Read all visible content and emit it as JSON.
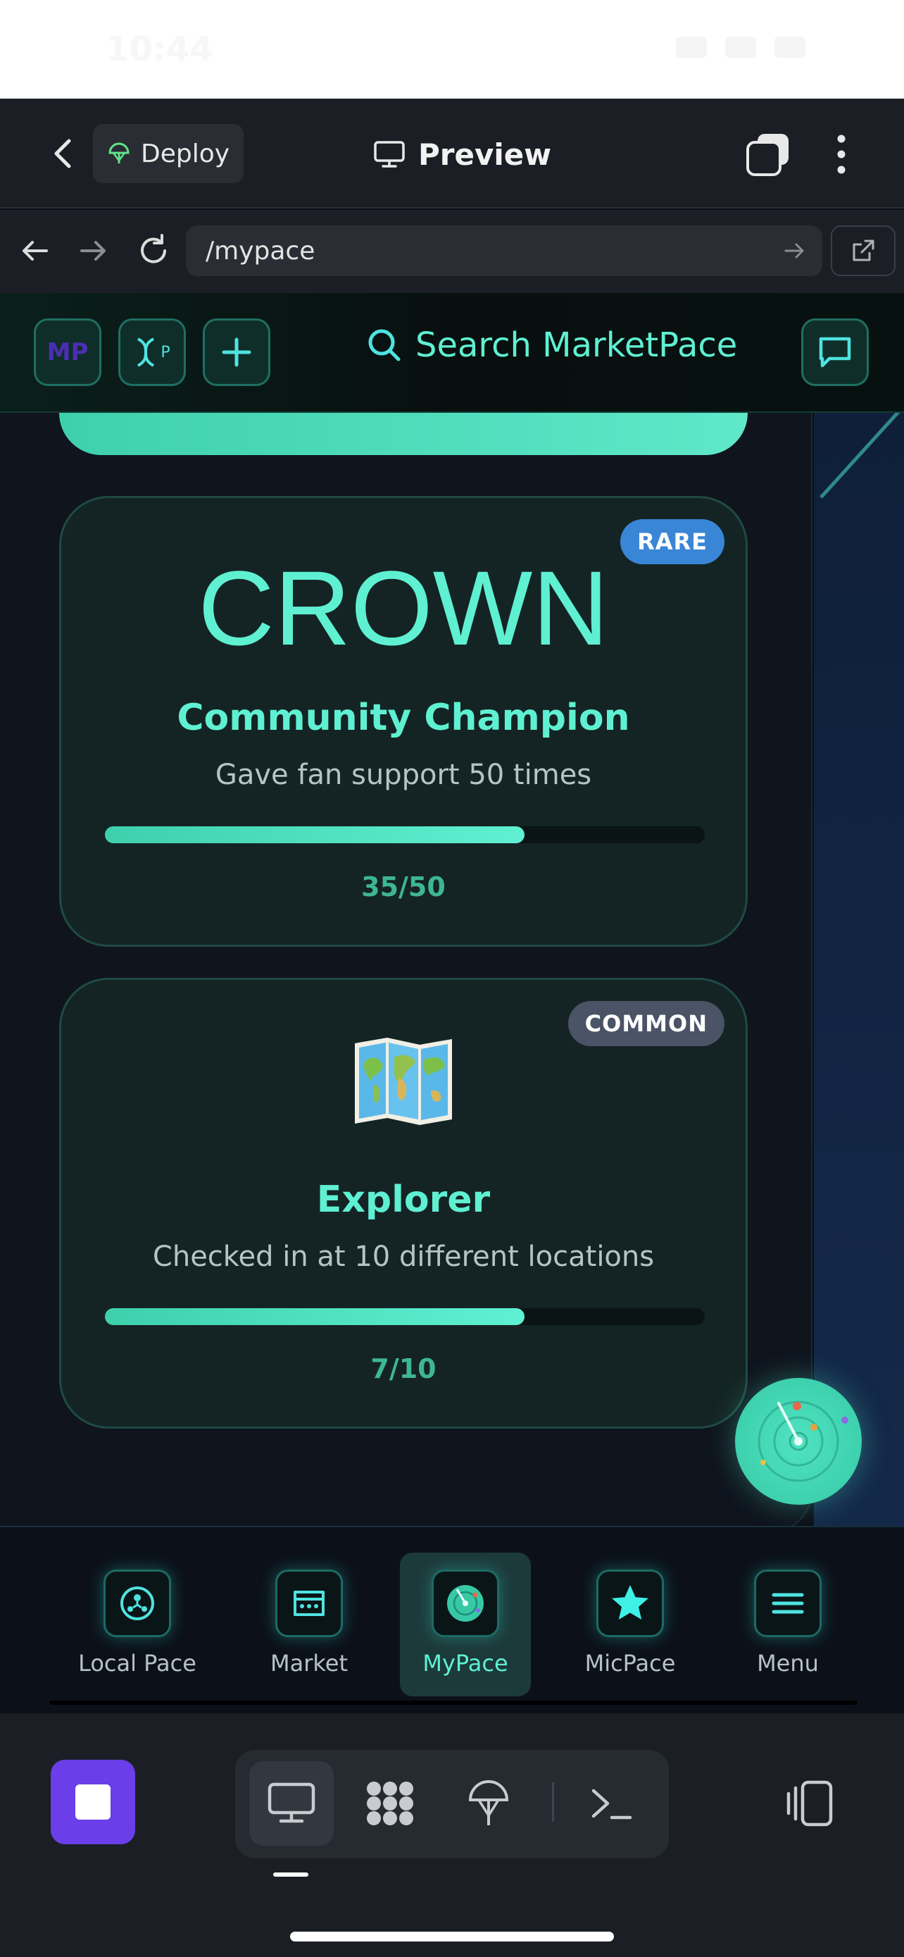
{
  "status_bar": {
    "time": "10:44"
  },
  "toolbar": {
    "deploy_label": "Deploy",
    "preview_label": "Preview"
  },
  "url_bar": {
    "url": "/mypace"
  },
  "app_header": {
    "logo_text": "MP",
    "second_btn_text": "P",
    "search_placeholder": "Search MarketPace"
  },
  "cards": [
    {
      "badge": "RARE",
      "icon_text": "CROWN",
      "title": "Community Champion",
      "description": "Gave fan support 50 times",
      "count": "35/50",
      "progress_fraction": 0.7
    },
    {
      "badge": "COMMON",
      "icon": "world-map-icon",
      "title": "Explorer",
      "description": "Checked in at 10 different locations",
      "count": "7/10",
      "progress_fraction": 0.7
    }
  ],
  "bottom_nav": {
    "items": [
      {
        "label": "Local Pace",
        "icon": "local-pace-icon"
      },
      {
        "label": "Market",
        "icon": "market-icon"
      },
      {
        "label": "MyPace",
        "icon": "mypace-radar-icon",
        "active": true
      },
      {
        "label": "MicPace",
        "icon": "star-icon"
      },
      {
        "label": "Menu",
        "icon": "menu-icon"
      }
    ]
  },
  "colors": {
    "accent": "#5ff0d2",
    "rare": "#3a86d6",
    "common": "#4a5466",
    "stop": "#6a3ee8"
  }
}
